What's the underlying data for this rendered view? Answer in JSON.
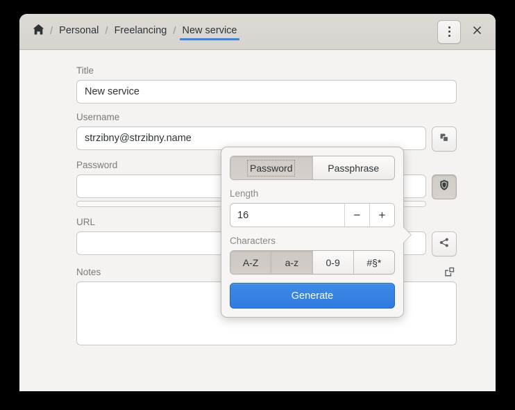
{
  "window": {
    "close_label": "×",
    "menu_label": "Main menu"
  },
  "breadcrumb": {
    "home_icon": "home-icon",
    "separator": "/",
    "items": [
      {
        "label": "Personal",
        "active": false
      },
      {
        "label": "Freelancing",
        "active": false
      },
      {
        "label": "New service",
        "active": true
      }
    ]
  },
  "form": {
    "title": {
      "label": "Title",
      "value": "New service"
    },
    "username": {
      "label": "Username",
      "value": "strzibny@strzibny.name",
      "action_icon": "copy-icon"
    },
    "password": {
      "label": "Password",
      "value": "",
      "action_icon": "shield-icon"
    },
    "url": {
      "label": "URL",
      "value": "",
      "action_icon": "share-icon"
    },
    "notes": {
      "label": "Notes",
      "value": "",
      "action_icon": "expand-icon"
    }
  },
  "popover": {
    "tabs": [
      {
        "label": "Password",
        "selected": true
      },
      {
        "label": "Passphrase",
        "selected": false
      }
    ],
    "length": {
      "label": "Length",
      "value": "16",
      "decrement_label": "−",
      "increment_label": "+"
    },
    "characters": {
      "label": "Characters",
      "options": [
        {
          "label": "A-Z",
          "enabled": true
        },
        {
          "label": "a-z",
          "enabled": true
        },
        {
          "label": "0-9",
          "enabled": false
        },
        {
          "label": "#§*",
          "enabled": false
        }
      ]
    },
    "generate_label": "Generate"
  },
  "colors": {
    "accent": "#3584e4",
    "headerbar": "#dad6d2",
    "body": "#f4f3f1",
    "text": "#2e3436",
    "muted": "#7c7a77"
  }
}
